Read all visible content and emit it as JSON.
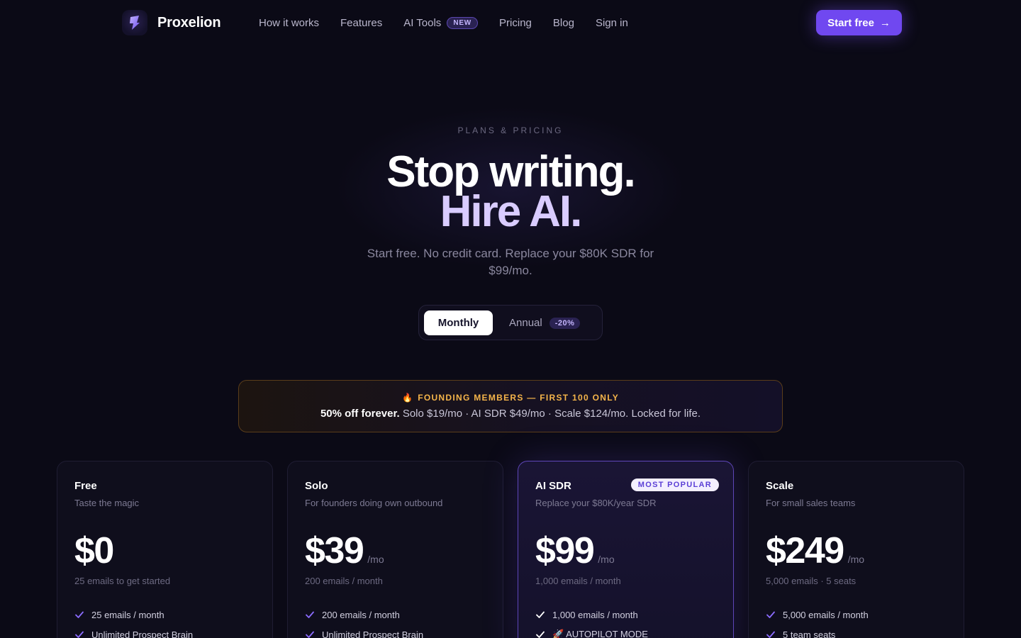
{
  "nav": {
    "brand": "Proxelion",
    "links": [
      "How it works",
      "Features",
      "AI Tools",
      "Pricing",
      "Blog",
      "Sign in"
    ],
    "new_badge": "NEW",
    "cta": "Start free",
    "cta_arrow": "→"
  },
  "hero": {
    "eyebrow": "PLANS & PRICING",
    "title_line1": "Stop writing.",
    "title_line2": "Hire AI.",
    "subtitle": "Start free. No credit card. Replace your $80K SDR for $99/mo."
  },
  "billing_toggle": {
    "monthly": "Monthly",
    "annual": "Annual",
    "annual_discount": "-20%",
    "selected": "Monthly"
  },
  "banner": {
    "icon": "🔥",
    "title": "FOUNDING MEMBERS — FIRST 100 ONLY",
    "bold": "50% off forever.",
    "body": " Solo $19/mo · AI SDR $49/mo · Scale $124/mo. Locked for life."
  },
  "colors": {
    "accent": "#7048f0",
    "banner_gold": "#f5b54a",
    "check": "#8b6cff"
  },
  "plans": [
    {
      "name": "Free",
      "desc": "Taste the magic",
      "price": "$0",
      "per": "",
      "note": "25 emails to get started",
      "features": [
        "25 emails / month",
        "Unlimited Prospect Brain"
      ]
    },
    {
      "name": "Solo",
      "desc": "For founders doing own outbound",
      "price": "$39",
      "per": "/mo",
      "note": "200 emails / month",
      "features": [
        "200 emails / month",
        "Unlimited Prospect Brain"
      ]
    },
    {
      "name": "AI SDR",
      "desc": "Replace your $80K/year SDR",
      "badge": "MOST POPULAR",
      "price": "$99",
      "per": "/mo",
      "note": "1,000 emails / month",
      "features": [
        "1,000 emails / month",
        "🚀 AUTOPILOT MODE"
      ]
    },
    {
      "name": "Scale",
      "desc": "For small sales teams",
      "price": "$249",
      "per": "/mo",
      "note": "5,000 emails · 5 seats",
      "features": [
        "5,000 emails / month",
        "5 team seats"
      ]
    }
  ]
}
